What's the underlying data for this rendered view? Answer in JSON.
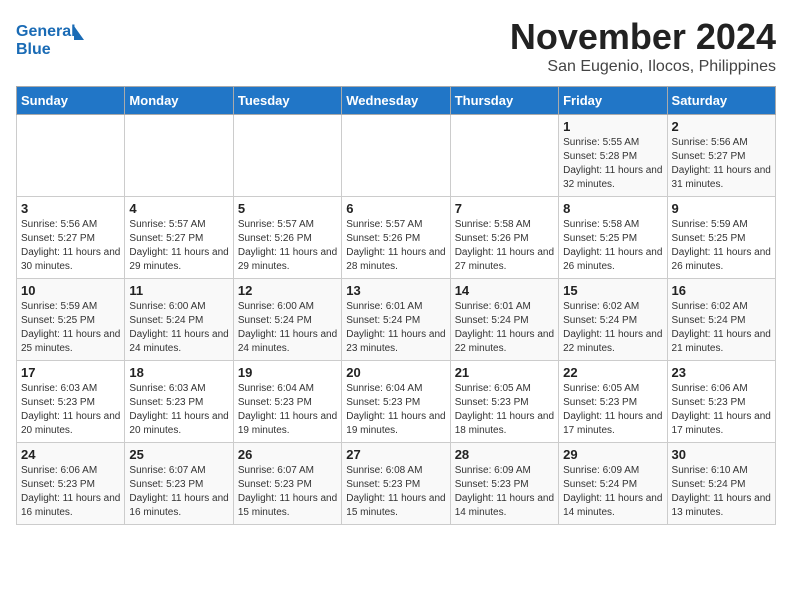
{
  "header": {
    "logo_line1": "General",
    "logo_line2": "Blue",
    "title": "November 2024",
    "subtitle": "San Eugenio, Ilocos, Philippines"
  },
  "weekdays": [
    "Sunday",
    "Monday",
    "Tuesday",
    "Wednesday",
    "Thursday",
    "Friday",
    "Saturday"
  ],
  "weeks": [
    [
      {
        "day": "",
        "info": ""
      },
      {
        "day": "",
        "info": ""
      },
      {
        "day": "",
        "info": ""
      },
      {
        "day": "",
        "info": ""
      },
      {
        "day": "",
        "info": ""
      },
      {
        "day": "1",
        "info": "Sunrise: 5:55 AM\nSunset: 5:28 PM\nDaylight: 11 hours and 32 minutes."
      },
      {
        "day": "2",
        "info": "Sunrise: 5:56 AM\nSunset: 5:27 PM\nDaylight: 11 hours and 31 minutes."
      }
    ],
    [
      {
        "day": "3",
        "info": "Sunrise: 5:56 AM\nSunset: 5:27 PM\nDaylight: 11 hours and 30 minutes."
      },
      {
        "day": "4",
        "info": "Sunrise: 5:57 AM\nSunset: 5:27 PM\nDaylight: 11 hours and 29 minutes."
      },
      {
        "day": "5",
        "info": "Sunrise: 5:57 AM\nSunset: 5:26 PM\nDaylight: 11 hours and 29 minutes."
      },
      {
        "day": "6",
        "info": "Sunrise: 5:57 AM\nSunset: 5:26 PM\nDaylight: 11 hours and 28 minutes."
      },
      {
        "day": "7",
        "info": "Sunrise: 5:58 AM\nSunset: 5:26 PM\nDaylight: 11 hours and 27 minutes."
      },
      {
        "day": "8",
        "info": "Sunrise: 5:58 AM\nSunset: 5:25 PM\nDaylight: 11 hours and 26 minutes."
      },
      {
        "day": "9",
        "info": "Sunrise: 5:59 AM\nSunset: 5:25 PM\nDaylight: 11 hours and 26 minutes."
      }
    ],
    [
      {
        "day": "10",
        "info": "Sunrise: 5:59 AM\nSunset: 5:25 PM\nDaylight: 11 hours and 25 minutes."
      },
      {
        "day": "11",
        "info": "Sunrise: 6:00 AM\nSunset: 5:24 PM\nDaylight: 11 hours and 24 minutes."
      },
      {
        "day": "12",
        "info": "Sunrise: 6:00 AM\nSunset: 5:24 PM\nDaylight: 11 hours and 24 minutes."
      },
      {
        "day": "13",
        "info": "Sunrise: 6:01 AM\nSunset: 5:24 PM\nDaylight: 11 hours and 23 minutes."
      },
      {
        "day": "14",
        "info": "Sunrise: 6:01 AM\nSunset: 5:24 PM\nDaylight: 11 hours and 22 minutes."
      },
      {
        "day": "15",
        "info": "Sunrise: 6:02 AM\nSunset: 5:24 PM\nDaylight: 11 hours and 22 minutes."
      },
      {
        "day": "16",
        "info": "Sunrise: 6:02 AM\nSunset: 5:24 PM\nDaylight: 11 hours and 21 minutes."
      }
    ],
    [
      {
        "day": "17",
        "info": "Sunrise: 6:03 AM\nSunset: 5:23 PM\nDaylight: 11 hours and 20 minutes."
      },
      {
        "day": "18",
        "info": "Sunrise: 6:03 AM\nSunset: 5:23 PM\nDaylight: 11 hours and 20 minutes."
      },
      {
        "day": "19",
        "info": "Sunrise: 6:04 AM\nSunset: 5:23 PM\nDaylight: 11 hours and 19 minutes."
      },
      {
        "day": "20",
        "info": "Sunrise: 6:04 AM\nSunset: 5:23 PM\nDaylight: 11 hours and 19 minutes."
      },
      {
        "day": "21",
        "info": "Sunrise: 6:05 AM\nSunset: 5:23 PM\nDaylight: 11 hours and 18 minutes."
      },
      {
        "day": "22",
        "info": "Sunrise: 6:05 AM\nSunset: 5:23 PM\nDaylight: 11 hours and 17 minutes."
      },
      {
        "day": "23",
        "info": "Sunrise: 6:06 AM\nSunset: 5:23 PM\nDaylight: 11 hours and 17 minutes."
      }
    ],
    [
      {
        "day": "24",
        "info": "Sunrise: 6:06 AM\nSunset: 5:23 PM\nDaylight: 11 hours and 16 minutes."
      },
      {
        "day": "25",
        "info": "Sunrise: 6:07 AM\nSunset: 5:23 PM\nDaylight: 11 hours and 16 minutes."
      },
      {
        "day": "26",
        "info": "Sunrise: 6:07 AM\nSunset: 5:23 PM\nDaylight: 11 hours and 15 minutes."
      },
      {
        "day": "27",
        "info": "Sunrise: 6:08 AM\nSunset: 5:23 PM\nDaylight: 11 hours and 15 minutes."
      },
      {
        "day": "28",
        "info": "Sunrise: 6:09 AM\nSunset: 5:23 PM\nDaylight: 11 hours and 14 minutes."
      },
      {
        "day": "29",
        "info": "Sunrise: 6:09 AM\nSunset: 5:24 PM\nDaylight: 11 hours and 14 minutes."
      },
      {
        "day": "30",
        "info": "Sunrise: 6:10 AM\nSunset: 5:24 PM\nDaylight: 11 hours and 13 minutes."
      }
    ]
  ]
}
